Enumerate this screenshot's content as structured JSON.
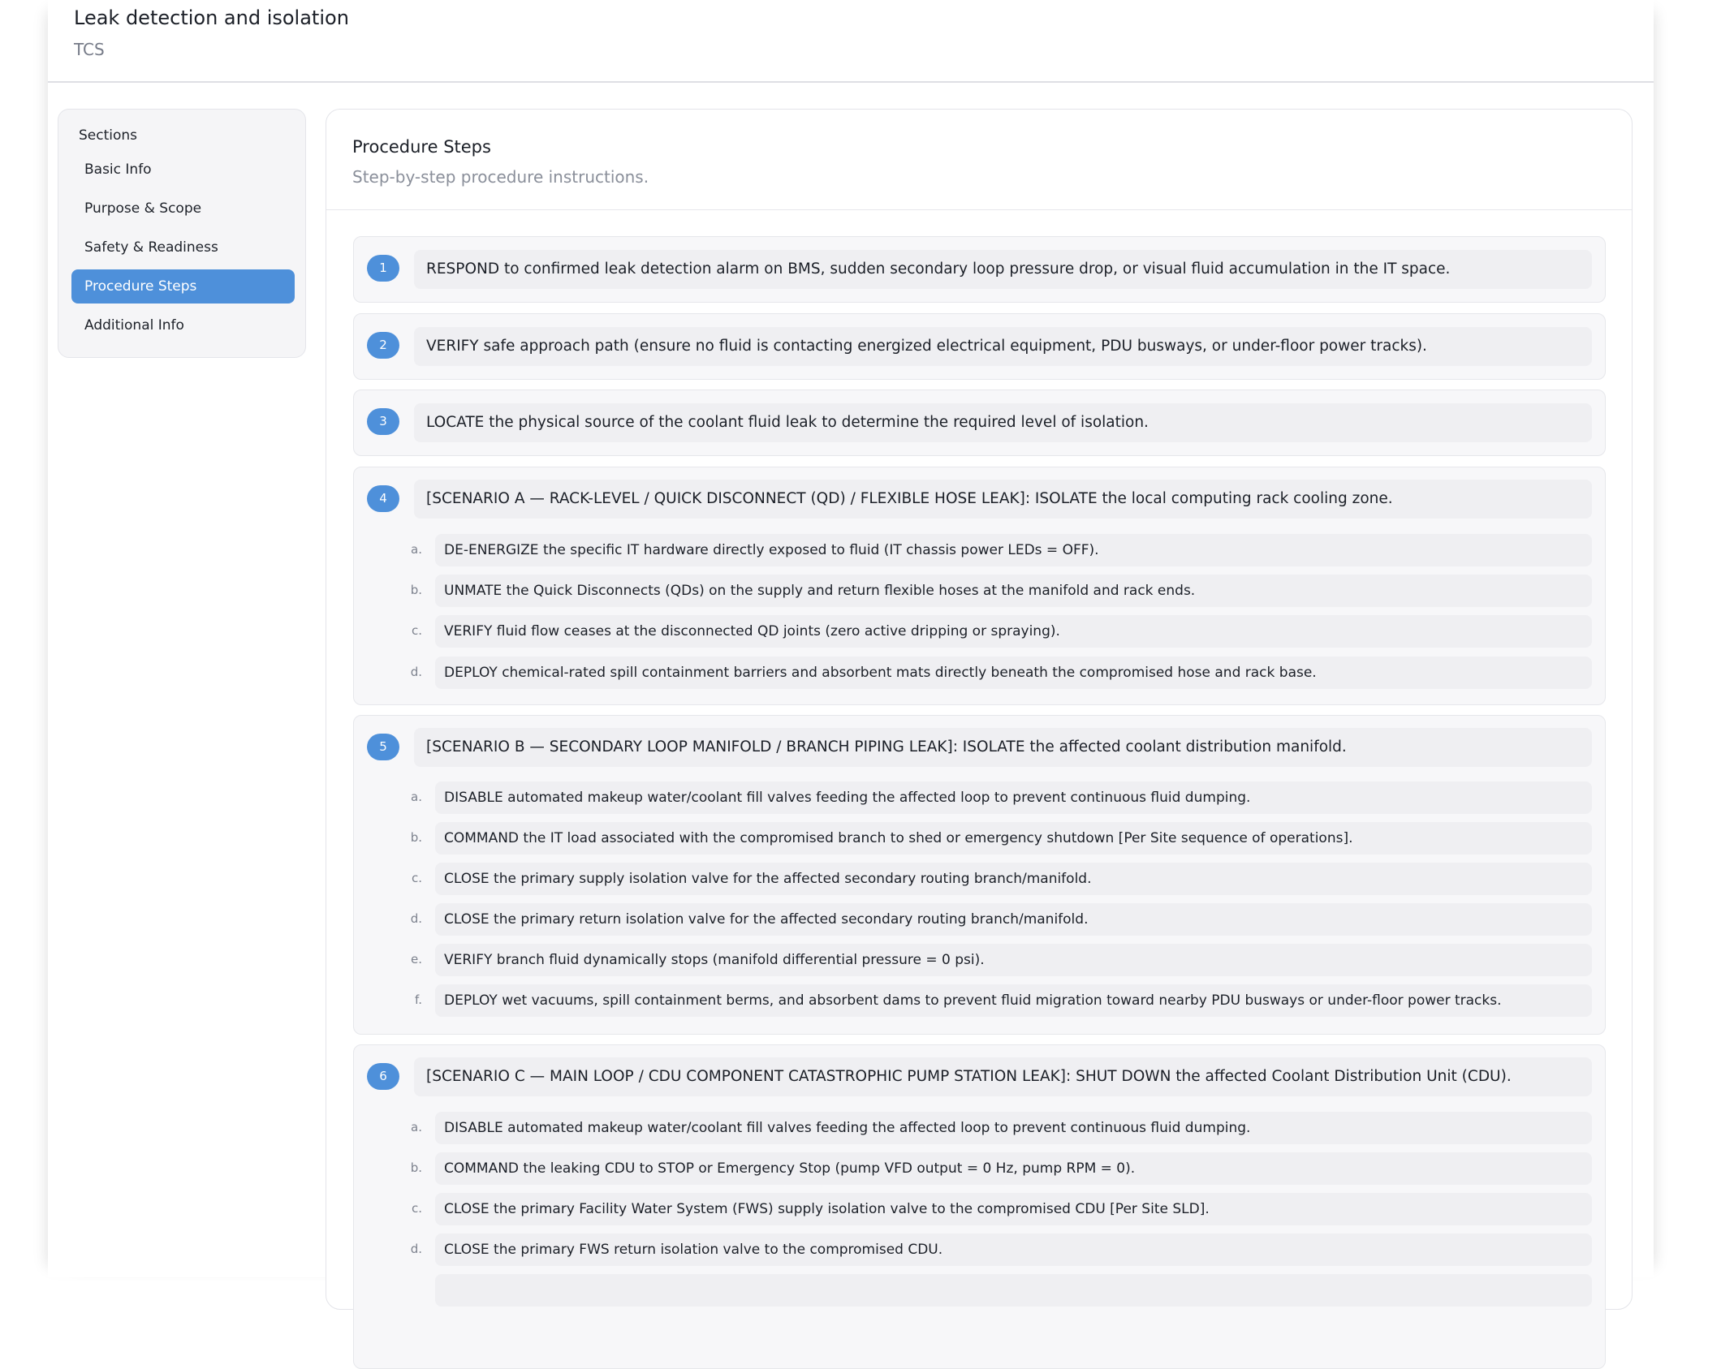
{
  "document": {
    "title": "Leak detection and isolation",
    "subtitle": "TCS"
  },
  "sidebar": {
    "title": "Sections",
    "items": [
      {
        "label": "Basic Info",
        "active": false
      },
      {
        "label": "Purpose & Scope",
        "active": false
      },
      {
        "label": "Safety & Readiness",
        "active": false
      },
      {
        "label": "Procedure Steps",
        "active": true
      },
      {
        "label": "Additional Info",
        "active": false
      }
    ]
  },
  "main": {
    "title": "Procedure Steps",
    "subtitle": "Step-by-step procedure instructions.",
    "steps": [
      {
        "number": "1",
        "text": "RESPOND to confirmed leak detection alarm on BMS, sudden secondary loop pressure drop, or visual fluid accumulation in the IT space.",
        "substeps": []
      },
      {
        "number": "2",
        "text": "VERIFY safe approach path (ensure no fluid is contacting energized electrical equipment, PDU busways, or under-floor power tracks).",
        "substeps": []
      },
      {
        "number": "3",
        "text": "LOCATE the physical source of the coolant fluid leak to determine the required level of isolation.",
        "substeps": []
      },
      {
        "number": "4",
        "text": "[SCENARIO A — RACK-LEVEL / QUICK DISCONNECT (QD) / FLEXIBLE HOSE LEAK]: ISOLATE the local computing rack cooling zone.",
        "substeps": [
          {
            "letter": "a.",
            "text": "DE-ENERGIZE the specific IT hardware directly exposed to fluid (IT chassis power LEDs = OFF)."
          },
          {
            "letter": "b.",
            "text": "UNMATE the Quick Disconnects (QDs) on the supply and return flexible hoses at the manifold and rack ends."
          },
          {
            "letter": "c.",
            "text": "VERIFY fluid flow ceases at the disconnected QD joints (zero active dripping or spraying)."
          },
          {
            "letter": "d.",
            "text": "DEPLOY chemical-rated spill containment barriers and absorbent mats directly beneath the compromised hose and rack base."
          }
        ]
      },
      {
        "number": "5",
        "text": "[SCENARIO B — SECONDARY LOOP MANIFOLD / BRANCH PIPING LEAK]: ISOLATE the affected coolant distribution manifold.",
        "substeps": [
          {
            "letter": "a.",
            "text": "DISABLE automated makeup water/coolant fill valves feeding the affected loop to prevent continuous fluid dumping."
          },
          {
            "letter": "b.",
            "text": "COMMAND the IT load associated with the compromised branch to shed or emergency shutdown [Per Site sequence of operations]."
          },
          {
            "letter": "c.",
            "text": "CLOSE the primary supply isolation valve for the affected secondary routing branch/manifold."
          },
          {
            "letter": "d.",
            "text": "CLOSE the primary return isolation valve for the affected secondary routing branch/manifold."
          },
          {
            "letter": "e.",
            "text": "VERIFY branch fluid dynamically stops (manifold differential pressure = 0 psi)."
          },
          {
            "letter": "f.",
            "text": "DEPLOY wet vacuums, spill containment berms, and absorbent dams to prevent fluid migration toward nearby PDU busways or under-floor power tracks."
          }
        ]
      },
      {
        "number": "6",
        "text": "[SCENARIO C — MAIN LOOP / CDU COMPONENT CATASTROPHIC PUMP STATION LEAK]: SHUT DOWN the affected Coolant Distribution Unit (CDU).",
        "substeps": [
          {
            "letter": "a.",
            "text": "DISABLE automated makeup water/coolant fill valves feeding the affected loop to prevent continuous fluid dumping."
          },
          {
            "letter": "b.",
            "text": "COMMAND the leaking CDU to STOP or Emergency Stop (pump VFD output = 0 Hz, pump RPM = 0)."
          },
          {
            "letter": "c.",
            "text": "CLOSE the primary Facility Water System (FWS) supply isolation valve to the compromised CDU [Per Site SLD]."
          },
          {
            "letter": "d.",
            "text": "CLOSE the primary FWS return isolation valve to the compromised CDU."
          }
        ]
      }
    ]
  }
}
